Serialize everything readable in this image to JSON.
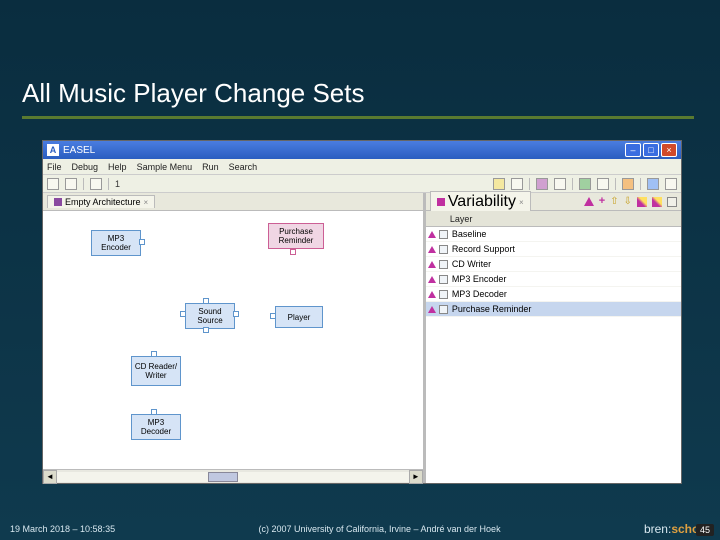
{
  "slide": {
    "title": "All Music Player Change Sets",
    "date": "19 March 2018 – 10:58:35",
    "copyright": "(c) 2007 University of California, Irvine – André van der Hoek",
    "page_num": "45",
    "logo_text": "bren:school"
  },
  "app": {
    "title": "EASEL",
    "menu": [
      "File",
      "Debug",
      "Help",
      "Sample Menu",
      "Run",
      "Search"
    ],
    "toolbar_value": "1",
    "left_tab": "Empty Architecture",
    "right_tab": "Variability",
    "layer_header": "Layer",
    "layers": [
      "Baseline",
      "Record Support",
      "CD Writer",
      "MP3 Encoder",
      "MP3 Decoder",
      "Purchase Reminder"
    ],
    "selected_layer_index": 5,
    "boxes": {
      "mp3enc": "MP3 Encoder",
      "purchase": "Purchase Reminder",
      "sound": "Sound Source",
      "player": "Player",
      "cdrw": "CD Reader/ Writer",
      "mp3dec": "MP3 Decoder"
    }
  }
}
